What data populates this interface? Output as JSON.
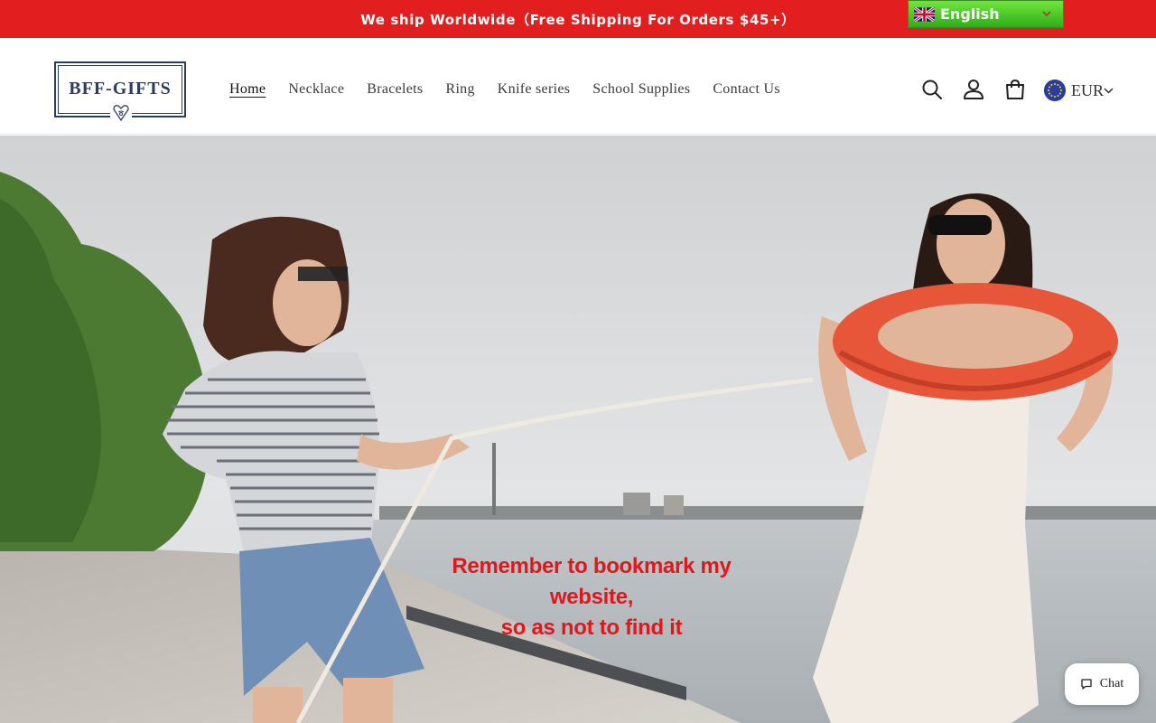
{
  "announcement": {
    "text": "We ship Worldwide（Free Shipping For Orders $45+）"
  },
  "language": {
    "selected": "English",
    "flag": "uk-flag-icon"
  },
  "brand": {
    "logo_text": "BFF-GIFTS"
  },
  "nav": {
    "items": [
      {
        "label": "Home",
        "active": true
      },
      {
        "label": "Necklace",
        "active": false
      },
      {
        "label": "Bracelets",
        "active": false
      },
      {
        "label": "Ring",
        "active": false
      },
      {
        "label": "Knife series",
        "active": false
      },
      {
        "label": "School Supplies",
        "active": false
      },
      {
        "label": "Contact Us",
        "active": false
      }
    ]
  },
  "header_icons": [
    "search-icon",
    "account-icon",
    "cart-icon"
  ],
  "currency": {
    "code": "EUR"
  },
  "hero": {
    "caption_line1": "Remember to bookmark my website,",
    "caption_line2": "so as not to find it"
  },
  "chat": {
    "label": "Chat"
  },
  "colors": {
    "announcement_bg": "#e21e1e",
    "brand_navy": "#2c3e5f",
    "caption_red": "#e0171b",
    "language_green": "#3cc424"
  }
}
